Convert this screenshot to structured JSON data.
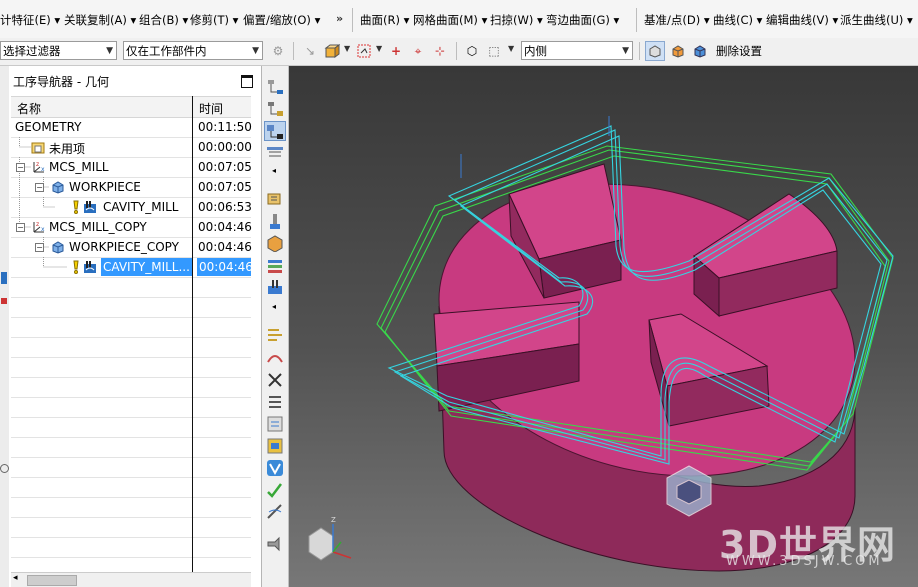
{
  "menubar": {
    "items": [
      {
        "label": "计特征(E)",
        "dd": "▾"
      },
      {
        "label": "关联复制(A)",
        "dd": "▾"
      },
      {
        "label": "组合(B)",
        "dd": "▾"
      },
      {
        "label": "修剪(T)",
        "dd": "▾"
      },
      {
        "label": "偏置/缩放(O)",
        "dd": "▾"
      },
      {
        "label": "曲面(R)",
        "dd": "▾"
      },
      {
        "label": "网格曲面(M)",
        "dd": "▾"
      },
      {
        "label": "扫掠(W)",
        "dd": "▾"
      },
      {
        "label": "弯边曲面(G)",
        "dd": "▾"
      },
      {
        "label": "基准/点(D)",
        "dd": "▾"
      },
      {
        "label": "曲线(C)",
        "dd": "▾"
      },
      {
        "label": "编辑曲线(V)",
        "dd": "▾"
      },
      {
        "label": "派生曲线(U)",
        "dd": "▾"
      }
    ],
    "overflow_glyph": "»"
  },
  "selection_bar": {
    "type_filter": "选择过滤器",
    "scope": "仅在工作部件内",
    "face_rule": "内侧",
    "delete_settings": "删除设置"
  },
  "navigator": {
    "title": "工序导航器 - 几何",
    "col_name": "名称",
    "col_time": "时间",
    "rows": [
      {
        "name": "GEOMETRY",
        "time": "00:11:50"
      },
      {
        "name": "未用项",
        "time": "00:00:00"
      },
      {
        "name": "MCS_MILL",
        "time": "00:07:05"
      },
      {
        "name": "WORKPIECE",
        "time": "00:07:05"
      },
      {
        "name": "CAVITY_MILL",
        "time": "00:06:53"
      },
      {
        "name": "MCS_MILL_COPY",
        "time": "00:04:46"
      },
      {
        "name": "WORKPIECE_COPY",
        "time": "00:04:46"
      },
      {
        "name": "CAVITY_MILL...",
        "time": "00:04:46"
      }
    ]
  },
  "viewport": {
    "part_color": "#c83a80",
    "toolpath_green": "#39d84a",
    "toolpath_cyan": "#35d4e0",
    "axis_labels": {
      "x": "X",
      "y": "Y",
      "z": "Z"
    }
  },
  "watermark": {
    "brand": "3D世界网",
    "url": "WWW.3DSJW.COM"
  },
  "colors": {
    "selection": "#3399ff",
    "accent_blue": "#2a6fbf"
  }
}
